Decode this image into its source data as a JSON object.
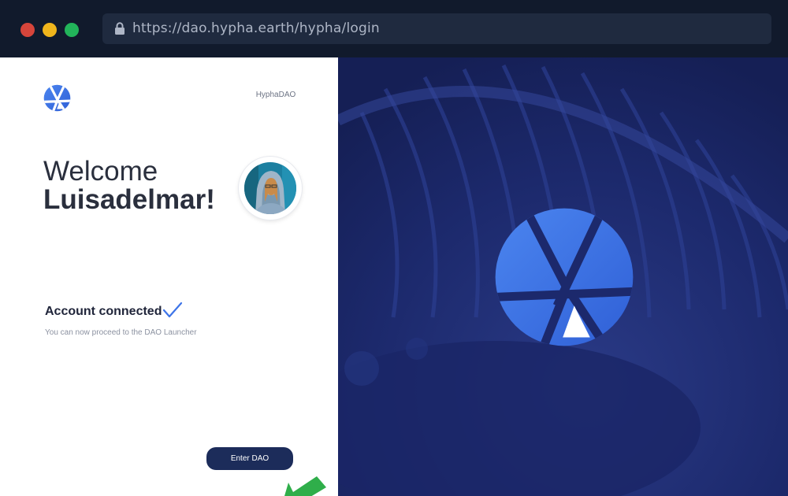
{
  "browser": {
    "url": "https://dao.hypha.earth/hypha/login"
  },
  "panel": {
    "dao_name": "HyphaDAO",
    "welcome": "Welcome",
    "username": "Luisadelmar!",
    "status_title": "Account connected",
    "status_sub": "You can now proceed to the DAO Launcher",
    "enter_button": "Enter DAO"
  },
  "colors": {
    "accent": "#3d74e8",
    "button": "#1c2c5a",
    "right_bg": "#1a2663",
    "arrow": "#2fae4a"
  },
  "icons": [
    "lock-icon",
    "hypha-logo-icon",
    "check-icon",
    "arrow-icon"
  ]
}
